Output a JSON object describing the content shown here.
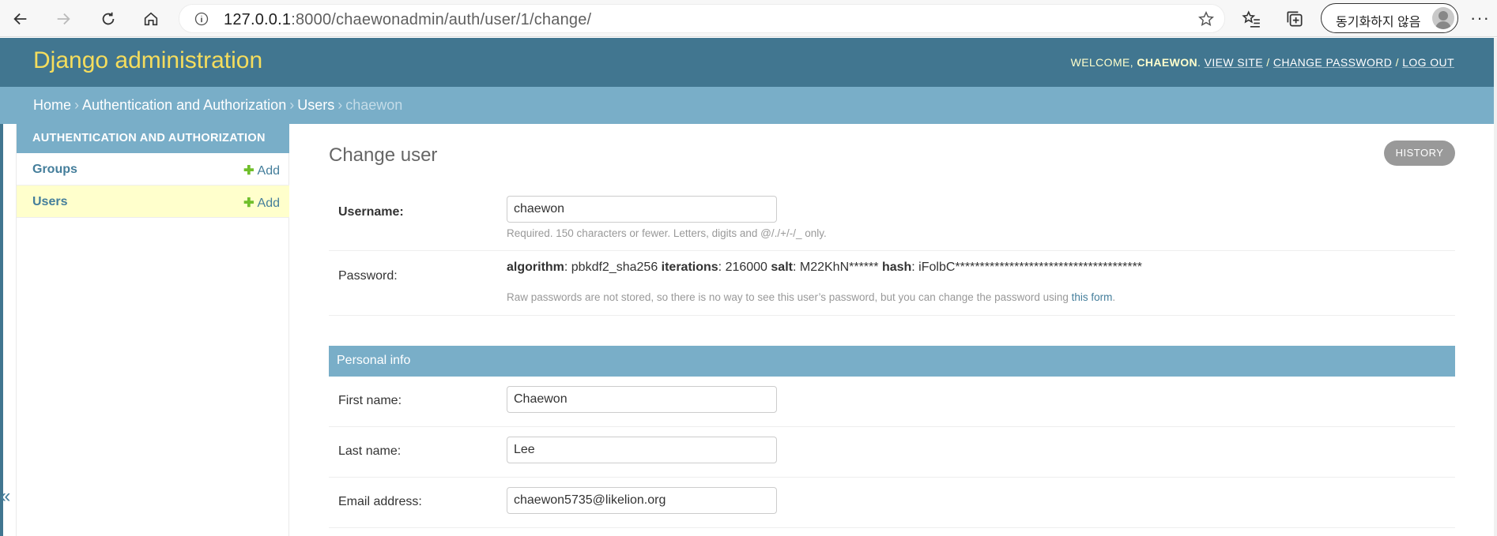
{
  "browser": {
    "url_host": "127.0.0.1",
    "url_rest": ":8000/chaewonadmin/auth/user/1/change/",
    "sync_label": "동기화하지 않음",
    "more": "···"
  },
  "header": {
    "branding": "Django administration",
    "welcome": "WELCOME, ",
    "username": "CHAEWON",
    "welcome_end": ". ",
    "view_site": "VIEW SITE",
    "change_password": "CHANGE PASSWORD",
    "log_out": "LOG OUT",
    "sep": " / "
  },
  "breadcrumbs": {
    "home": "Home",
    "app": "Authentication and Authorization",
    "model": "Users",
    "current": "chaewon",
    "sep": "›"
  },
  "sidebar": {
    "caption": "AUTHENTICATION AND AUTHORIZATION",
    "items": [
      {
        "label": "Groups",
        "add": "Add"
      },
      {
        "label": "Users",
        "add": "Add"
      }
    ],
    "collapse": "«"
  },
  "content": {
    "title": "Change user",
    "history": "HISTORY",
    "username": {
      "label": "Username:",
      "value": "chaewon",
      "help": "Required. 150 characters or fewer. Letters, digits and @/./+/-/_ only."
    },
    "password": {
      "label": "Password:",
      "algorithm_key": "algorithm",
      "algorithm_val": ": pbkdf2_sha256 ",
      "iterations_key": "iterations",
      "iterations_val": ": 216000 ",
      "salt_key": "salt",
      "salt_val": ": M22KhN****** ",
      "hash_key": "hash",
      "hash_val": ": iFolbC**************************************",
      "help_pre": "Raw passwords are not stored, so there is no way to see this user’s password, but you can change the password using ",
      "help_link": "this form",
      "help_post": "."
    },
    "personal_info": {
      "heading": "Personal info",
      "first_name_label": "First name:",
      "first_name": "Chaewon",
      "last_name_label": "Last name:",
      "last_name": "Lee",
      "email_label": "Email address:",
      "email": "chaewon5735@likelion.org"
    }
  },
  "colors": {
    "header": "#417690",
    "breadcrumbs": "#79aec8",
    "branding": "#f5dd5d",
    "link": "#447e9b",
    "add_plus": "#70bf2b",
    "current_row": "#ffffcc"
  }
}
